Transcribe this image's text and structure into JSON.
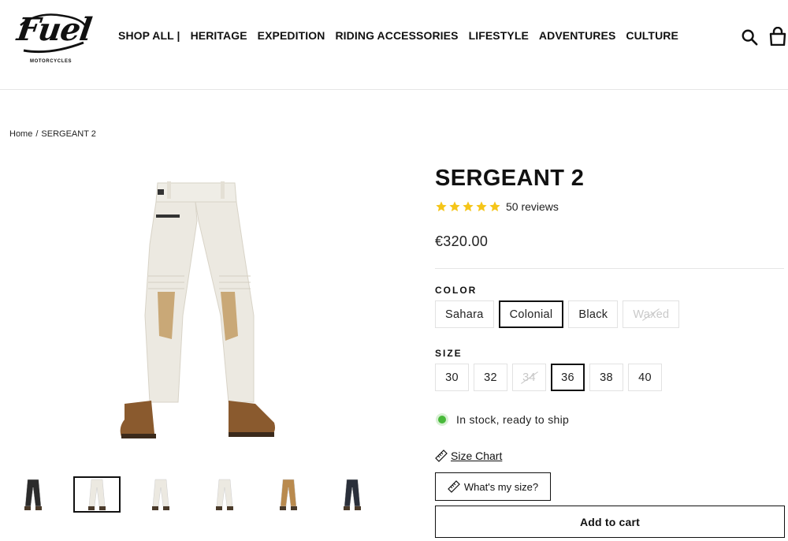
{
  "brand": {
    "logo_text": "Fuel",
    "logo_sub": "MOTORCYCLES"
  },
  "nav": [
    "SHOP ALL |",
    "HERITAGE",
    "EXPEDITION",
    "RIDING ACCESSORIES",
    "LIFESTYLE",
    "ADVENTURES",
    "CULTURE"
  ],
  "header_icons": {
    "search": "search-icon",
    "cart": "cart-icon"
  },
  "breadcrumb": {
    "home": "Home",
    "separator": "/",
    "current": "SERGEANT 2"
  },
  "product": {
    "title": "SERGEANT 2",
    "rating": 5,
    "reviews": "50 reviews",
    "price": "€320.00"
  },
  "color": {
    "label": "COLOR",
    "options": [
      "Sahara",
      "Colonial",
      "Black",
      "Waxed"
    ],
    "selected": "Colonial",
    "unavailable": [
      "Waxed"
    ]
  },
  "size": {
    "label": "SIZE",
    "options": [
      "30",
      "32",
      "34",
      "36",
      "38",
      "40"
    ],
    "selected": "36",
    "unavailable": [
      "34"
    ]
  },
  "stock": {
    "text": "In stock, ready to ship",
    "color": "#48b93a"
  },
  "size_chart": "Size Chart",
  "whats_my_size": "What's my size?",
  "add_to_cart": "Add to cart",
  "thumbnails": [
    {
      "name": "thumb-black-pants",
      "color": "#2b2b2b"
    },
    {
      "name": "thumb-colonial-front",
      "color": "#ece9e1"
    },
    {
      "name": "thumb-colonial-side",
      "color": "#ece9e1"
    },
    {
      "name": "thumb-colonial-back",
      "color": "#ece9e1"
    },
    {
      "name": "thumb-sahara",
      "color": "#b98a4e"
    },
    {
      "name": "thumb-navy",
      "color": "#2a2f3a"
    }
  ],
  "thumbnail_selected": 1,
  "colors": {
    "accent": "#111111",
    "star": "#f5c518",
    "pants": "#ece9e1",
    "knee_patch": "#c9a877",
    "boots": "#8a5a2e"
  }
}
